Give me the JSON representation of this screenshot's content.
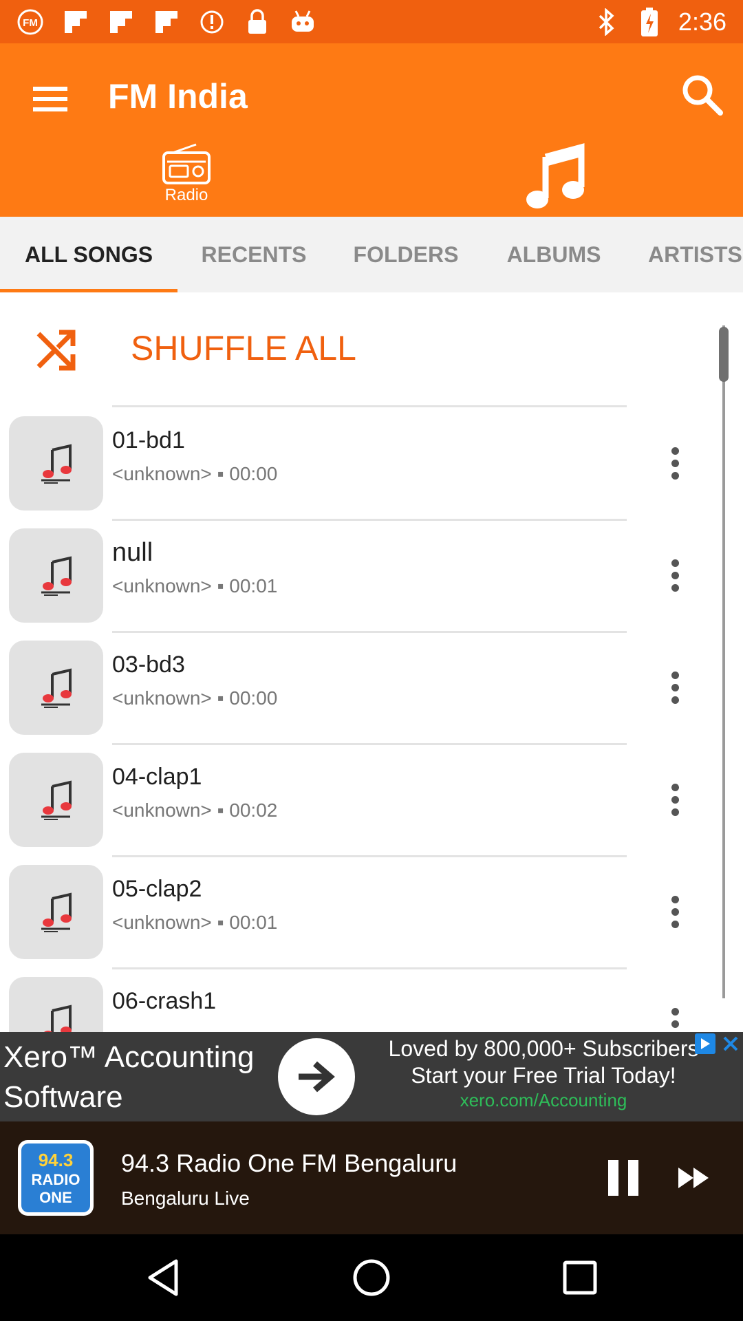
{
  "status_bar": {
    "time": "2:36",
    "left_icons": [
      "fm-app-icon",
      "flipboard-icon",
      "flipboard-icon",
      "flipboard-icon",
      "alert-icon",
      "lock-icon",
      "android-debug-icon"
    ],
    "right_icons": [
      "bluetooth-icon",
      "charging-icon"
    ]
  },
  "app_bar": {
    "title": "FM India",
    "radio_label": "Radio"
  },
  "tabs": [
    {
      "label": "ALL SONGS",
      "active": true
    },
    {
      "label": "RECENTS",
      "active": false
    },
    {
      "label": "FOLDERS",
      "active": false
    },
    {
      "label": "ALBUMS",
      "active": false
    },
    {
      "label": "ARTISTS",
      "active": false
    }
  ],
  "shuffle": {
    "label": "SHUFFLE ALL"
  },
  "songs": [
    {
      "title": "01-bd1",
      "meta": "<unknown> ▪ 00:00"
    },
    {
      "title": "null",
      "meta": "<unknown> ▪ 00:01"
    },
    {
      "title": "03-bd3",
      "meta": "<unknown> ▪ 00:00"
    },
    {
      "title": "04-clap1",
      "meta": "<unknown> ▪ 00:02"
    },
    {
      "title": "05-clap2",
      "meta": "<unknown> ▪ 00:01"
    },
    {
      "title": "06-crash1",
      "meta": ""
    }
  ],
  "ad": {
    "left_text": "Xero™ Accounting Software",
    "line1": "Loved by 800,000+ Subscribers",
    "line2": "Start your Free Trial Today!",
    "url": "xero.com/Accounting"
  },
  "player": {
    "title": "94.3 Radio One FM Bengaluru",
    "subtitle": "Bengaluru Live",
    "logo_line1": "94.3",
    "logo_line2": "RADIO",
    "logo_line3": "ONE"
  },
  "colors": {
    "status_bar": "#f0600f",
    "app_bar": "#fe7a14",
    "accent": "#f0600f",
    "player_bg": "#25170d",
    "ad_bg": "#3a3a3a",
    "ad_url": "#2ebd59"
  }
}
